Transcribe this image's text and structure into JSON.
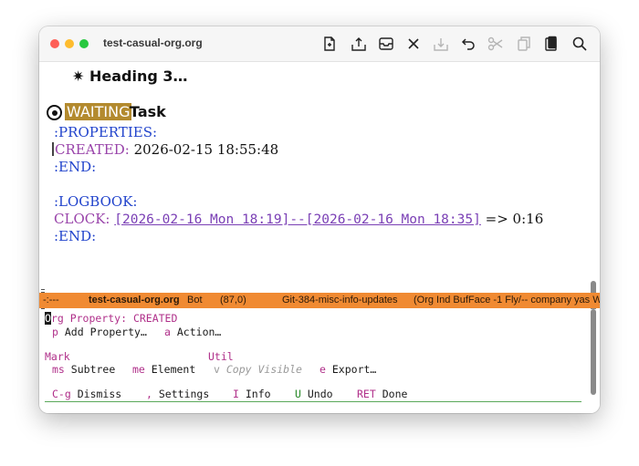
{
  "window": {
    "title": "test-casual-org.org",
    "toolbar_icons": [
      "new-file-icon",
      "upload-icon",
      "inbox-tray-icon",
      "close-icon",
      "download-icon",
      "undo-icon",
      "scissors-icon",
      "copy-icon",
      "paste-icon",
      "search-icon"
    ]
  },
  "editor": {
    "heading3": "✷ Heading 3…",
    "task": {
      "keyword": "WAITING",
      "title": "Task"
    },
    "properties_drawer": {
      "open": ":PROPERTIES:",
      "created_key": "CREATED:",
      "created_value": "2026-02-15 18:55:48",
      "end": ":END:"
    },
    "logbook_drawer": {
      "open": ":LOGBOOK:",
      "clock_key": "CLOCK:",
      "clock_range": "[2026-02-16 Mon 18:19]--[2026-02-16 Mon 18:35]",
      "arrow": "=>",
      "duration": "0:16",
      "end": ":END:"
    }
  },
  "modeline": {
    "state": "-:---",
    "buffer_name": "test-casual-org.org",
    "position": "Bot",
    "line_col": "(87,0)",
    "branch": "Git-384-misc-info-updates",
    "modes": "(Org Ind BufFace -1 Fly/-- company yas W"
  },
  "menu": {
    "header_first_char": "O",
    "header_rest": "rg Property: CREATED",
    "items_row1": [
      {
        "key": "p",
        "label": "Add Property…"
      },
      {
        "key": "a",
        "label": "Action…"
      }
    ],
    "group_mark": "Mark",
    "group_util": "Util",
    "items_row2": [
      {
        "key": "ms",
        "label": "Subtree"
      },
      {
        "key": "me",
        "label": "Element"
      },
      {
        "key": "v",
        "label": "Copy Visible",
        "disabled": true
      },
      {
        "key": "e",
        "label": "Export…"
      }
    ],
    "items_row3": [
      {
        "key": "C-g",
        "label": "Dismiss"
      },
      {
        "key": ",",
        "label": "Settings"
      },
      {
        "key": "I",
        "label": "Info"
      },
      {
        "key": "U",
        "label": "Undo"
      },
      {
        "key": "RET",
        "label": "Done"
      }
    ]
  },
  "colors": {
    "keyword_bg": "#b38a2e",
    "drawer_blue": "#2244cc",
    "property_purple": "#9944aa",
    "link_purple": "#7a3fb5",
    "modeline_orange": "#f08a32",
    "menu_key_magenta": "#b0308a"
  }
}
